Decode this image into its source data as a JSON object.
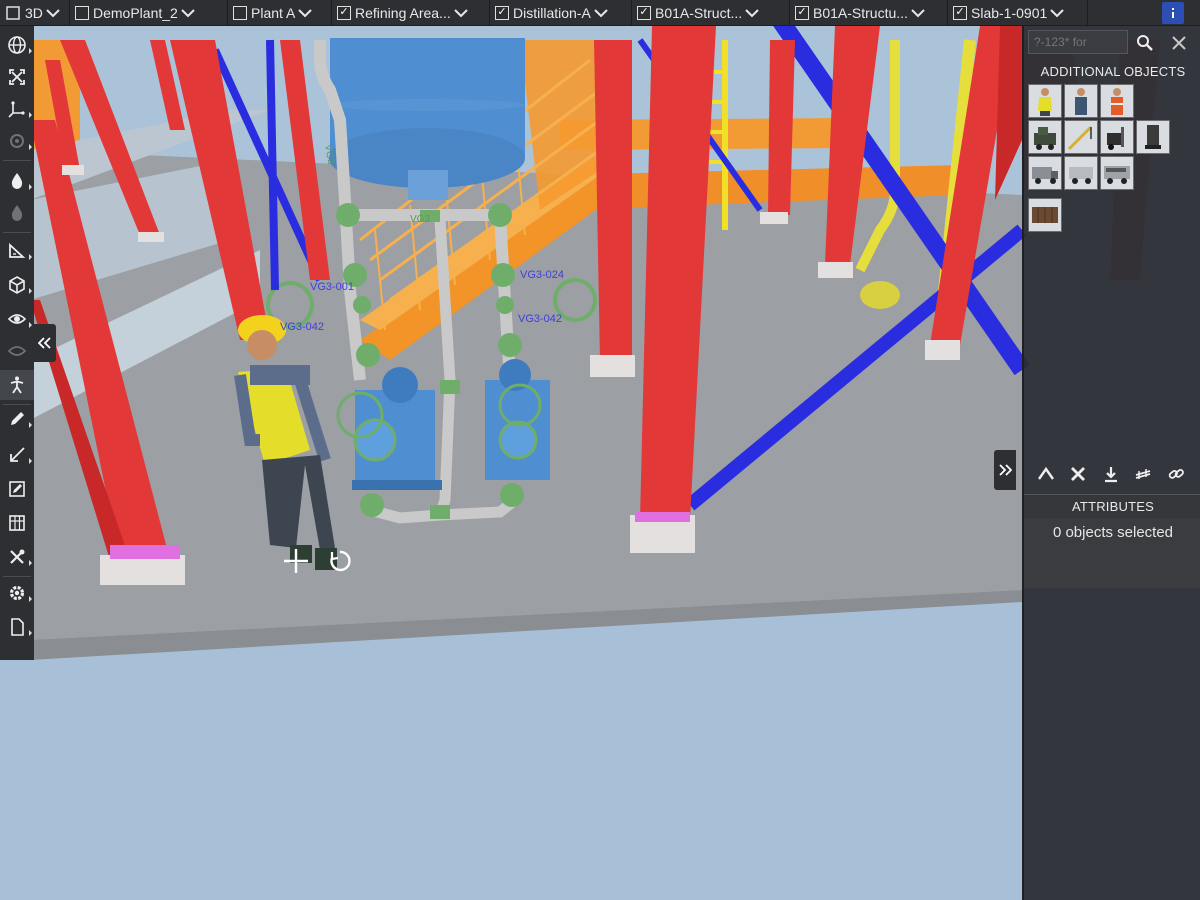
{
  "breadcrumb": [
    {
      "label": "3D",
      "checkbox": false
    },
    {
      "label": "DemoPlant_2",
      "checkbox": true,
      "checked": false
    },
    {
      "label": "Plant A",
      "checkbox": true,
      "checked": false
    },
    {
      "label": "Refining Area...",
      "checkbox": true,
      "checked": true
    },
    {
      "label": "Distillation-A",
      "checkbox": true,
      "checked": true
    },
    {
      "label": "B01A-Struct...",
      "checkbox": true,
      "checked": true
    },
    {
      "label": "B01A-Structu...",
      "checkbox": true,
      "checked": true
    },
    {
      "label": "Slab-1-0901",
      "checkbox": true,
      "checked": true
    }
  ],
  "right_panel": {
    "search_placeholder": "?-123* for",
    "additional_objects_title": "ADDITIONAL OBJECTS",
    "attributes_title": "ATTRIBUTES",
    "attributes_status": "0 objects selected"
  },
  "scene_labels": {
    "valve_left_1": "VG3-001",
    "valve_left_2": "VG3-042",
    "valve_right_1": "VG3-024",
    "valve_right_2": "VG3-042"
  },
  "colors": {
    "toolbar_bg": "#2d2f33",
    "steel_red": "#e33838",
    "brace_blue": "#2a2ce0",
    "stair_orange": "#f29428",
    "pipe_green": "#6fae6a",
    "vessel_blue": "#4f8ed0",
    "floor_grey": "#9fa3a8",
    "sky": "#a9c3da"
  },
  "icons": {
    "left_toolbar": [
      "globe-icon",
      "fit-view-icon",
      "axes-icon",
      "settings-cube-icon",
      "drop-icon",
      "drop-dim-icon",
      "measure-icon",
      "cube-icon",
      "eye-icon",
      "eye-dim-icon",
      "walk-icon",
      "pencil-icon",
      "markup-arrow-icon",
      "edit-box-icon",
      "table-icon",
      "tools-icon",
      "gear-icon",
      "document-icon"
    ],
    "panel_actions": [
      "shuffle-icon",
      "close-icon",
      "download-icon",
      "fence-icon",
      "link-icon"
    ]
  }
}
